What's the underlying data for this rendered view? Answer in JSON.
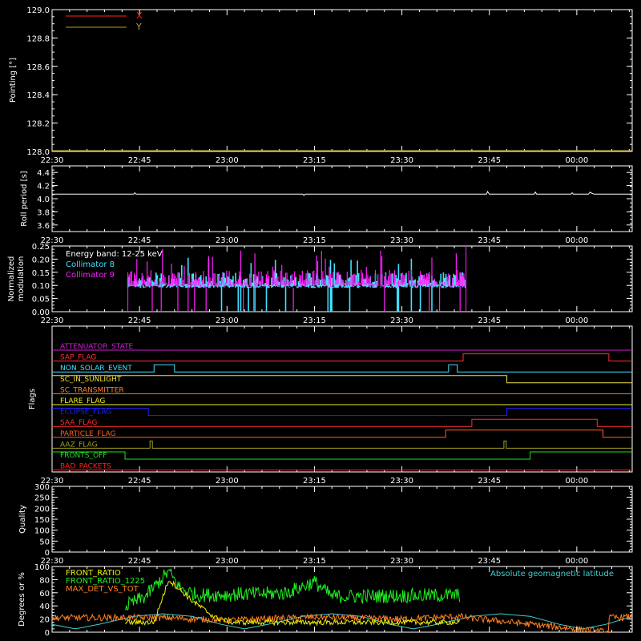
{
  "colors": {
    "background": "#000000",
    "axes": "#ffffff"
  },
  "x_ticks": [
    {
      "t": 0,
      "label": "22:30"
    },
    {
      "t": 15,
      "label": "22:45"
    },
    {
      "t": 30,
      "label": "23:00"
    },
    {
      "t": 45,
      "label": "23:15"
    },
    {
      "t": 60,
      "label": "23:30"
    },
    {
      "t": 75,
      "label": "23:45"
    },
    {
      "t": 90,
      "label": "00:00"
    }
  ],
  "chart_data": [
    {
      "id": "pointing",
      "type": "line",
      "ylabel": "Pointing [°]",
      "ylim": [
        128.0,
        129.0
      ],
      "yticks": [
        "128.0",
        "128.2",
        "128.4",
        "128.6",
        "128.8",
        "129.0"
      ],
      "series": [
        {
          "name": "X",
          "color": "#ff2020",
          "values": []
        },
        {
          "name": "Y",
          "color": "#b8a020",
          "values": []
        }
      ]
    },
    {
      "id": "roll",
      "type": "line",
      "ylabel": "Roll period [s]",
      "ylim": [
        3.5,
        4.5
      ],
      "yticks": [
        "3.6",
        "3.8",
        "4.0",
        "4.2",
        "4.4"
      ],
      "series": [
        {
          "color": "#ffffff",
          "points": [
            [
              0,
              4.07
            ],
            [
              14,
              4.07
            ],
            [
              14.2,
              4.09
            ],
            [
              14.4,
              4.07
            ],
            [
              43,
              4.07
            ],
            [
              43.2,
              4.05
            ],
            [
              43.4,
              4.07
            ],
            [
              74.5,
              4.07
            ],
            [
              74.7,
              4.11
            ],
            [
              75,
              4.07
            ],
            [
              82.7,
              4.07
            ],
            [
              82.9,
              4.1
            ],
            [
              83.1,
              4.07
            ],
            [
              89,
              4.07
            ],
            [
              89.2,
              4.09
            ],
            [
              89.4,
              4.07
            ],
            [
              92,
              4.07
            ],
            [
              92.3,
              4.1
            ],
            [
              92.6,
              4.08
            ],
            [
              93,
              4.07
            ],
            [
              99.5,
              4.07
            ]
          ]
        }
      ]
    },
    {
      "id": "modulation",
      "type": "bar",
      "ylabel": "Normalized modulation",
      "ylim": [
        0.0,
        0.25
      ],
      "yticks": [
        "0.00",
        "0.05",
        "0.10",
        "0.15",
        "0.20",
        "0.25"
      ],
      "annotation": "Energy band: 12-25 keV",
      "t_range": [
        13,
        71
      ],
      "series": [
        {
          "name": "Collimator 8",
          "color": "#40e0ff"
        },
        {
          "name": "Collimator 9",
          "color": "#ff20ff"
        }
      ]
    },
    {
      "id": "flags",
      "type": "line",
      "ylabel": "Flags",
      "series": [
        {
          "name": "ATTENUATOR_STATE",
          "color": "#d020d0",
          "steps": [
            [
              0,
              0
            ],
            [
              99.5,
              0
            ]
          ]
        },
        {
          "name": "SAP_FLAG",
          "color": "#ff3030",
          "steps": [
            [
              0,
              0
            ],
            [
              70.5,
              0
            ],
            [
              70.5,
              1
            ],
            [
              95.5,
              1
            ],
            [
              95.5,
              0
            ],
            [
              99.5,
              0
            ]
          ]
        },
        {
          "name": "NON_SOLAR_EVENT",
          "color": "#40e0ff",
          "steps": [
            [
              0,
              0
            ],
            [
              17.5,
              0
            ],
            [
              17.5,
              1
            ],
            [
              21,
              1
            ],
            [
              21,
              0
            ],
            [
              68,
              0
            ],
            [
              68,
              1
            ],
            [
              69.5,
              1
            ],
            [
              69.5,
              0
            ],
            [
              99.5,
              0
            ]
          ]
        },
        {
          "name": "SC_IN_SUNLIGHT",
          "color": "#f0e040",
          "steps": [
            [
              0,
              1
            ],
            [
              78,
              1
            ],
            [
              78,
              0
            ],
            [
              99.5,
              0
            ]
          ]
        },
        {
          "name": "SC_TRANSMITTER",
          "color": "#ff8020",
          "steps": [
            [
              0,
              0
            ],
            [
              99.5,
              0
            ]
          ]
        },
        {
          "name": "FLARE_FLAG",
          "color": "#f0f020",
          "steps": [
            [
              0,
              0
            ],
            [
              99.5,
              0
            ]
          ]
        },
        {
          "name": "ECLIPSE_FLAG",
          "color": "#2020ff",
          "steps": [
            [
              0,
              1
            ],
            [
              16.5,
              1
            ],
            [
              16.5,
              0
            ],
            [
              78,
              0
            ],
            [
              78,
              1
            ],
            [
              99.5,
              1
            ]
          ]
        },
        {
          "name": "SAA_FLAG",
          "color": "#ff3030",
          "steps": [
            [
              0,
              0
            ],
            [
              72,
              0
            ],
            [
              72,
              1
            ],
            [
              93.5,
              1
            ],
            [
              93.5,
              0
            ],
            [
              99.5,
              0
            ]
          ]
        },
        {
          "name": "PARTICLE_FLAG",
          "color": "#ff6020",
          "steps": [
            [
              0,
              0
            ],
            [
              67.5,
              0
            ],
            [
              67.5,
              1
            ],
            [
              94.5,
              1
            ],
            [
              94.5,
              0
            ],
            [
              99.5,
              0
            ]
          ]
        },
        {
          "name": "AAZ_FLAG",
          "color": "#a0a020",
          "steps": [
            [
              0,
              0
            ],
            [
              16.8,
              0
            ],
            [
              16.8,
              1
            ],
            [
              17.2,
              1
            ],
            [
              17.2,
              0
            ],
            [
              77.5,
              0
            ],
            [
              77.5,
              1
            ],
            [
              77.9,
              1
            ],
            [
              77.9,
              0
            ],
            [
              99.5,
              0
            ]
          ]
        },
        {
          "name": "FRONTS_OFF",
          "color": "#20e020",
          "steps": [
            [
              0,
              1
            ],
            [
              12.5,
              1
            ],
            [
              12.5,
              0
            ],
            [
              82,
              0
            ],
            [
              82,
              1
            ],
            [
              99.5,
              1
            ]
          ]
        },
        {
          "name": "BAD_PACKETS",
          "color": "#ff2020",
          "steps": [
            [
              0,
              0
            ],
            [
              99.5,
              0
            ]
          ]
        }
      ]
    },
    {
      "id": "quality",
      "type": "line",
      "ylabel": "Quality",
      "ylim": [
        0,
        300
      ],
      "yticks": [
        "0",
        "50",
        "100",
        "150",
        "200",
        "250",
        "300"
      ],
      "series": []
    },
    {
      "id": "ratios",
      "type": "line",
      "ylabel": "Degrees or %",
      "ylim": [
        0,
        100
      ],
      "yticks": [
        "0",
        "20",
        "40",
        "60",
        "80",
        "100"
      ],
      "right_label": "Absolute geomagnetic latitude",
      "series": [
        {
          "name": "FRONT_RATIO",
          "color": "#f0f000",
          "envelope": [
            [
              12.5,
              15
            ],
            [
              17.5,
              15
            ],
            [
              20,
              80
            ],
            [
              24,
              48
            ],
            [
              28,
              22
            ],
            [
              31,
              15
            ],
            [
              70,
              15
            ]
          ]
        },
        {
          "name": "FRONT_RATIO_1225",
          "color": "#20f020",
          "envelope": [
            [
              12.5,
              35
            ],
            [
              16,
              50
            ],
            [
              20,
              88
            ],
            [
              22,
              62
            ],
            [
              25,
              52
            ],
            [
              40,
              55
            ],
            [
              45,
              72
            ],
            [
              48,
              50
            ],
            [
              70,
              52
            ]
          ]
        },
        {
          "name": "MAX_DET_VS_TOT",
          "color": "#ff8020",
          "envelope": [
            [
              0,
              22
            ],
            [
              20,
              22
            ],
            [
              30,
              18
            ],
            [
              45,
              23
            ],
            [
              60,
              20
            ],
            [
              70,
              24
            ],
            [
              71,
              22
            ],
            [
              95.5,
              0
            ],
            [
              95.5,
              22
            ],
            [
              99.5,
              23
            ]
          ]
        },
        {
          "name": "Absolute geomagnetic latitude",
          "color": "#40d0d0",
          "points": [
            [
              0,
              12
            ],
            [
              4,
              5
            ],
            [
              8,
              12
            ],
            [
              14,
              24
            ],
            [
              19,
              28
            ],
            [
              24,
              24
            ],
            [
              29,
              12
            ],
            [
              33,
              5
            ],
            [
              37,
              12
            ],
            [
              43,
              24
            ],
            [
              48,
              28
            ],
            [
              53,
              24
            ],
            [
              58,
              12
            ],
            [
              62,
              5
            ],
            [
              66,
              12
            ],
            [
              72,
              24
            ],
            [
              77,
              28
            ],
            [
              82,
              24
            ],
            [
              87,
              12
            ],
            [
              91,
              5
            ],
            [
              95,
              12
            ],
            [
              99.5,
              24
            ]
          ]
        }
      ]
    }
  ]
}
